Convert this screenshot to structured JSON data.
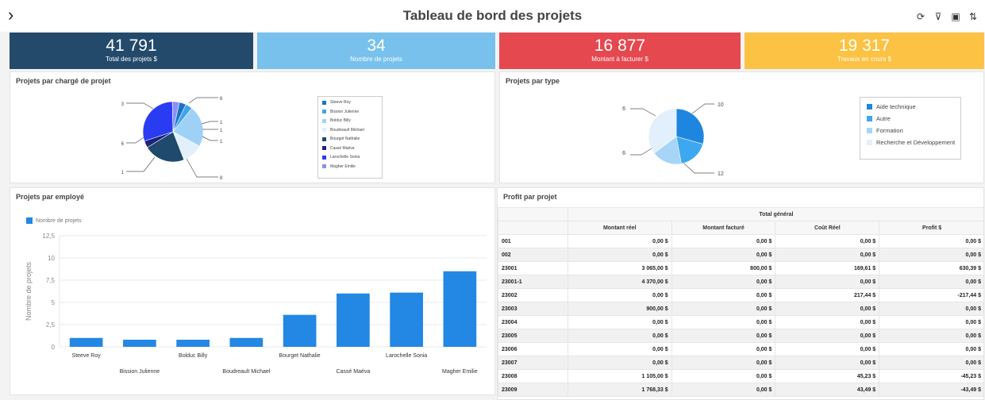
{
  "header": {
    "title": "Tableau de bord des projets"
  },
  "kpis": [
    {
      "value": "41 791",
      "label": "Total des projets $",
      "color": "#244a6b"
    },
    {
      "value": "34",
      "label": "Nombre de projets",
      "color": "#77c1ec"
    },
    {
      "value": "16 877",
      "label": "Montant à facturer $",
      "color": "#e5484f"
    },
    {
      "value": "19 317",
      "label": "Travaux en cours $",
      "color": "#fbc243"
    }
  ],
  "pie1": {
    "title": "Projets par chargé de projet",
    "outer_labels": [
      "6",
      "1",
      "1",
      "1",
      "8",
      "1",
      "6",
      "3"
    ],
    "legend": [
      "Steeve Roy",
      "Bission Julienne",
      "Bolduc Billy",
      "Boudreault Michael",
      "Bourget Nathalie",
      "Cassé Maéva",
      "Larochelle Sonia",
      "Magher Emilie"
    ]
  },
  "pie2": {
    "title": "Projets par type",
    "outer_labels": [
      "10",
      "12",
      "6",
      "6"
    ],
    "legend": [
      "Aide technique",
      "Autre",
      "Formation",
      "Recherche et Développement"
    ]
  },
  "bar": {
    "title": "Projets par employé",
    "legend": "Nombre de projets",
    "ylabel": "Nombre de projets",
    "ticks": [
      "12,5",
      "10",
      "7,5",
      "5",
      "2,5",
      "0"
    ]
  },
  "chart_data": [
    {
      "type": "pie",
      "title": "Projets par chargé de projet",
      "labels": [
        "Steeve Roy",
        "Bission Julienne",
        "Bolduc Billy",
        "Boudreault Michael",
        "Bourget Nathalie",
        "Cassé Maéva",
        "Larochelle Sonia",
        "Magher Emilie"
      ],
      "values": [
        1,
        1,
        6,
        3,
        6,
        1,
        8,
        1
      ],
      "colors": [
        "#1a73c8",
        "#3ea4ef",
        "#9fd1f7",
        "#e2f0fc",
        "#1f4a6e",
        "#1b237a",
        "#2a3cf2",
        "#8a90f5"
      ]
    },
    {
      "type": "pie",
      "title": "Projets par type",
      "labels": [
        "Aide technique",
        "Autre",
        "Formation",
        "Recherche et Développement"
      ],
      "values": [
        10,
        6,
        6,
        12
      ],
      "colors": [
        "#1f86e0",
        "#3ea7f2",
        "#a6d5f8",
        "#e1f0fc"
      ]
    },
    {
      "type": "bar",
      "title": "Projets par employé",
      "categories": [
        "Steeve Roy",
        "Bission Julienne",
        "Bolduc Billy",
        "Boudreault Michael",
        "Bourget Nathalie",
        "Cassé Maéva",
        "Larochelle Sonia",
        "Magher Emilie"
      ],
      "series": [
        {
          "name": "Nombre de projets",
          "values": [
            1,
            0.8,
            0.8,
            1,
            3.6,
            6,
            6.1,
            8.5
          ]
        }
      ],
      "ylabel": "Nombre de projets",
      "ylim": [
        0,
        12.5
      ],
      "color": "#2387e4"
    }
  ],
  "profit": {
    "title": "Profit par projet",
    "group_header": "Total général",
    "columns": [
      "Montant réel",
      "Montant facturé",
      "Coût Réel",
      "Profit $"
    ],
    "rows": [
      [
        "001",
        "0,00 $",
        "0,00 $",
        "0,00 $",
        "0,00 $"
      ],
      [
        "002",
        "0,00 $",
        "0,00 $",
        "0,00 $",
        "0,00 $"
      ],
      [
        "23001",
        "3 065,00 $",
        "800,00 $",
        "169,61 $",
        "630,39 $"
      ],
      [
        "23001-1",
        "4 370,00 $",
        "0,00 $",
        "0,00 $",
        "0,00 $"
      ],
      [
        "23002",
        "0,00 $",
        "0,00 $",
        "217,44 $",
        "-217,44 $"
      ],
      [
        "23003",
        "900,00 $",
        "0,00 $",
        "0,00 $",
        "0,00 $"
      ],
      [
        "23004",
        "0,00 $",
        "0,00 $",
        "0,00 $",
        "0,00 $"
      ],
      [
        "23005",
        "0,00 $",
        "0,00 $",
        "0,00 $",
        "0,00 $"
      ],
      [
        "23006",
        "0,00 $",
        "0,00 $",
        "0,00 $",
        "0,00 $"
      ],
      [
        "23007",
        "0,00 $",
        "0,00 $",
        "0,00 $",
        "0,00 $"
      ],
      [
        "23008",
        "1 105,00 $",
        "0,00 $",
        "45,23 $",
        "-45,23 $"
      ],
      [
        "23009",
        "1 768,33 $",
        "0,00 $",
        "43,49 $",
        "-43,49 $"
      ]
    ]
  }
}
